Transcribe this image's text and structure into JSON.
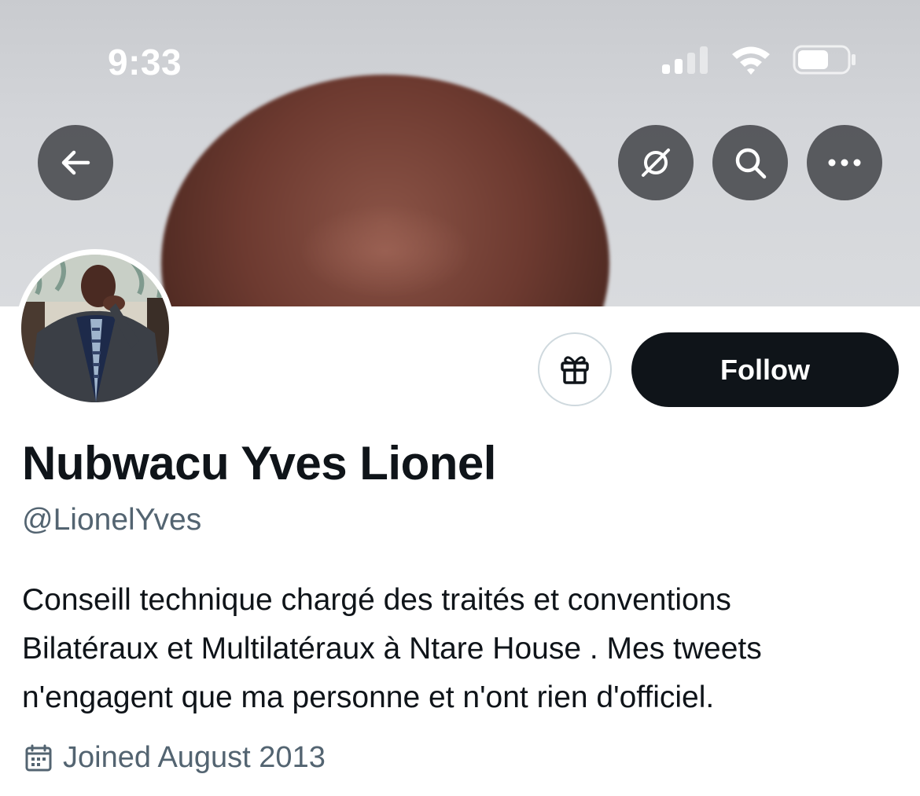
{
  "status_bar": {
    "time": "9:33"
  },
  "header": {
    "back_icon": "arrow-left-icon",
    "grok_icon": "slashed-circle-icon",
    "search_icon": "search-icon",
    "more_icon": "more-horizontal-icon"
  },
  "profile": {
    "display_name": "Nubwacu Yves Lionel",
    "handle": "@LionelYves",
    "bio_lines": [
      "Conseill technique chargé des traités et conventions",
      "Bilatéraux et Multilatéraux à Ntare House . Mes tweets",
      "n'engagent que ma personne et n'ont rien d'officiel."
    ],
    "joined": "Joined August 2013",
    "follow_label": "Follow",
    "gift_icon": "gift-icon",
    "calendar_icon": "calendar-icon"
  },
  "colors": {
    "text_primary": "#0f1419",
    "text_secondary": "#536471",
    "follow_bg": "#0f1419",
    "border": "#cfd9de"
  }
}
